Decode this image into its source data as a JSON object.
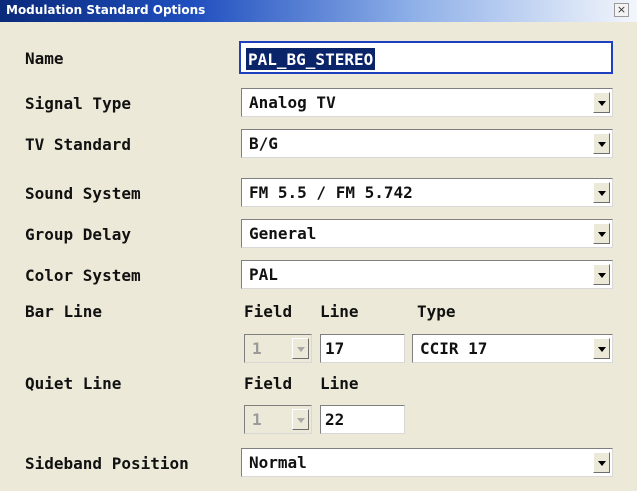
{
  "window": {
    "title": "Modulation Standard Options",
    "close_glyph": "×"
  },
  "name": {
    "label": "Name",
    "value": "PAL_BG_STEREO"
  },
  "signal_type": {
    "label": "Signal Type",
    "value": "Analog TV"
  },
  "tv_standard": {
    "label": "TV Standard",
    "value": "B/G"
  },
  "sound_system": {
    "label": "Sound System",
    "value": "FM 5.5 / FM 5.742"
  },
  "group_delay": {
    "label": "Group Delay",
    "value": "General"
  },
  "color_system": {
    "label": "Color System",
    "value": "PAL"
  },
  "bar_line": {
    "label": "Bar Line",
    "field_header": "Field",
    "line_header": "Line",
    "type_header": "Type",
    "field_value": "1",
    "line_value": "17",
    "type_value": "CCIR 17"
  },
  "quiet_line": {
    "label": "Quiet Line",
    "field_header": "Field",
    "line_header": "Line",
    "field_value": "1",
    "line_value": "22"
  },
  "sideband_position": {
    "label": "Sideband Position",
    "value": "Normal"
  },
  "icons": {
    "dropdown": "chevron-down-icon",
    "close": "close-icon"
  },
  "colors": {
    "dialog_bg": "#ece9d8",
    "selection": "#0a246a",
    "focus_border": "#1e3fbf"
  }
}
